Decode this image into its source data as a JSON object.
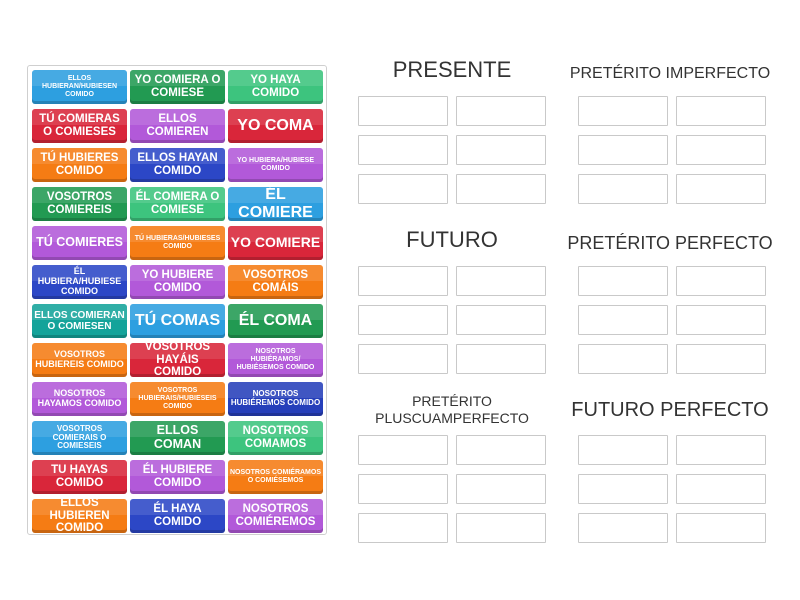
{
  "tiles": [
    {
      "text": "ELLOS HUBIERAN/HUBIESEN COMIDO",
      "color": "#2d9fe0"
    },
    {
      "text": "YO COMIERA O COMIESE",
      "color": "#229a52"
    },
    {
      "text": "YO HAYA COMIDO",
      "color": "#3dc47e"
    },
    {
      "text": "TÚ COMIERAS O COMIESES",
      "color": "#d9263a"
    },
    {
      "text": "ELLOS COMIEREN",
      "color": "#b259d9"
    },
    {
      "text": "YO COMA",
      "color": "#d9263a"
    },
    {
      "text": "TÚ HUBIERES COMIDO",
      "color": "#f57c14"
    },
    {
      "text": "ELLOS HAYAN COMIDO",
      "color": "#2c47c6"
    },
    {
      "text": "YO HUBIERA/HUBIESE COMIDO",
      "color": "#b259d9"
    },
    {
      "text": "VOSOTROS COMIEREIS",
      "color": "#229a52"
    },
    {
      "text": "ÉL COMIERA O COMIESE",
      "color": "#3dc47e"
    },
    {
      "text": "ÉL COMIERE",
      "color": "#2d9fe0"
    },
    {
      "text": "TÚ COMIERES",
      "color": "#b259d9"
    },
    {
      "text": "TÚ HUBIERAS/HUBIESES COMIDO",
      "color": "#f57c14"
    },
    {
      "text": "YO COMIERE",
      "color": "#d9263a"
    },
    {
      "text": "ÉL HUBIERA/HUBIESE COMIDO",
      "color": "#2c47c6"
    },
    {
      "text": "YO HUBIERE COMIDO",
      "color": "#b259d9"
    },
    {
      "text": "VOSOTROS COMÁIS",
      "color": "#f57c14"
    },
    {
      "text": "ELLOS COMIERAN O COMIESEN",
      "color": "#14a39a"
    },
    {
      "text": "TÚ COMAS",
      "color": "#2d9fe0"
    },
    {
      "text": "ÉL COMA",
      "color": "#229a52"
    },
    {
      "text": "VOSOTROS HUBIEREIS COMIDO",
      "color": "#f57c14"
    },
    {
      "text": "VOSOTROS HAYÁIS COMIDO",
      "color": "#d9263a"
    },
    {
      "text": "NOSOTROS HUBIÉRAMOS/ HUBIÉSEMOS COMIDO",
      "color": "#b259d9"
    },
    {
      "text": "NOSOTROS HAYAMOS COMIDO",
      "color": "#b259d9"
    },
    {
      "text": "VOSOTROS HUBIERAIS/HUBIESEIS COMIDO",
      "color": "#f57c14"
    },
    {
      "text": "NOSOTROS HUBIÉREMOS COMIDO",
      "color": "#263fba"
    },
    {
      "text": "VOSOTROS COMIERAIS O COMIESEIS",
      "color": "#2d9fe0"
    },
    {
      "text": "ELLOS COMAN",
      "color": "#229a52"
    },
    {
      "text": "NOSOTROS COMAMOS",
      "color": "#3dc47e"
    },
    {
      "text": "TU HAYAS COMIDO",
      "color": "#d9263a"
    },
    {
      "text": "ÉL HUBIERE COMIDO",
      "color": "#b259d9"
    },
    {
      "text": "NOSOTROS COMIÉRAMOS O COMIÉSEMOS",
      "color": "#f57c14"
    },
    {
      "text": "ELLOS HUBIEREN COMIDO",
      "color": "#f57c14"
    },
    {
      "text": "ÉL HAYA COMIDO",
      "color": "#2c47c6"
    },
    {
      "text": "NOSOTROS COMIÉREMOS",
      "color": "#b259d9"
    }
  ],
  "groups": [
    {
      "title": "PRESENTE"
    },
    {
      "title": "PRETÉRITO IMPERFECTO"
    },
    {
      "title": "FUTURO"
    },
    {
      "title": "PRETÉRITO PERFECTO"
    },
    {
      "title": "PRETÉRITO PLUSCUAMPERFECTO"
    },
    {
      "title": "FUTURO PERFECTO"
    }
  ]
}
